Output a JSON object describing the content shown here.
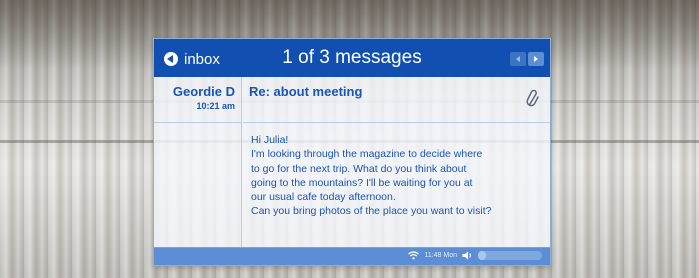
{
  "header": {
    "back_label": "inbox",
    "title": "1 of 3 messages"
  },
  "message": {
    "sender": "Geordie D",
    "time": "10:21 am",
    "subject": "Re: about meeting",
    "body_lines": [
      "Hi Julia!",
      "I'm looking through the magazine to decide where",
      "to go for the next trip. What do you think about",
      "going to the mountains? I'll be waiting for you at",
      "our usual cafe today afternoon.",
      "Can you bring photos of the place you want to visit?"
    ]
  },
  "status": {
    "time": "11:48 Mon",
    "volume_level": 0.12
  },
  "icons": {
    "back": "back-arrow-icon",
    "prev": "chevron-left-icon",
    "next": "chevron-right-icon",
    "attachment": "paperclip-icon",
    "wifi": "wifi-icon",
    "volume": "speaker-icon"
  },
  "colors": {
    "title_bar": "#1150b0",
    "accent_text": "#1a55b0",
    "status_bar": "#5b8ed4"
  }
}
